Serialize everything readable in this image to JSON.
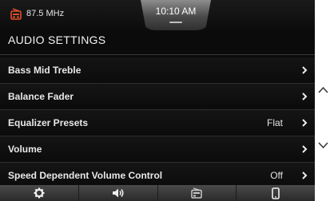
{
  "status": {
    "frequency": "87.5 MHz",
    "time": "10:10 AM",
    "source_icon": "radio-icon"
  },
  "title": "AUDIO SETTINGS",
  "menu": [
    {
      "label": "Bass Mid Treble",
      "value": ""
    },
    {
      "label": "Balance Fader",
      "value": ""
    },
    {
      "label": "Equalizer Presets",
      "value": "Flat"
    },
    {
      "label": "Volume",
      "value": ""
    },
    {
      "label": "Speed Dependent Volume Control",
      "value": "Off"
    }
  ],
  "bottom_bar": [
    "settings-icon",
    "audio-icon",
    "radio-icon",
    "phone-icon"
  ],
  "colors": {
    "accent": "#e0502a",
    "background": "#0b0b0b",
    "text": "#e8e8e8"
  }
}
